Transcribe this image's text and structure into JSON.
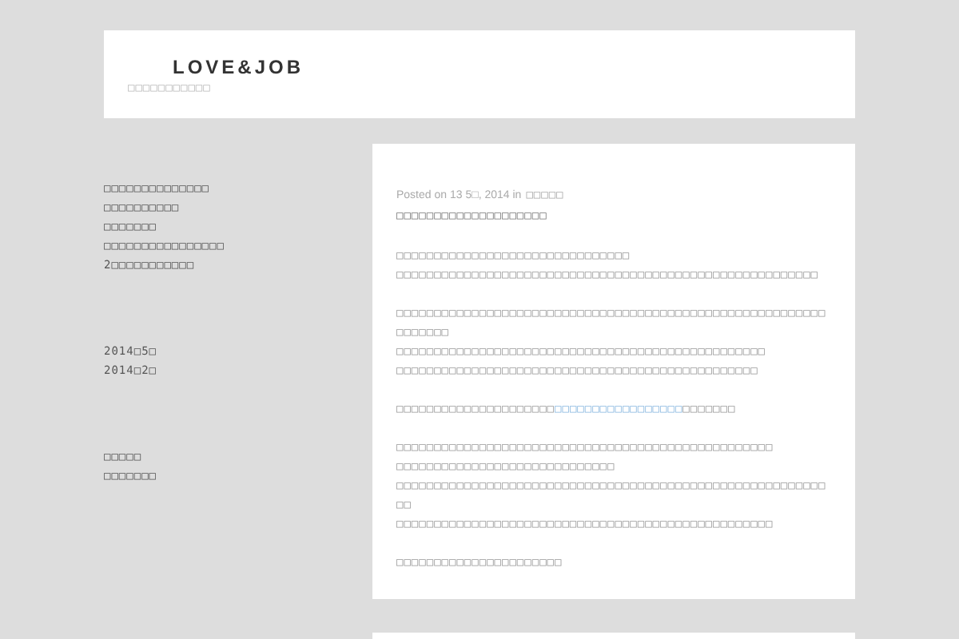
{
  "header": {
    "title": "LOVE&JOB",
    "tagline": "□□□□□□□□□□□"
  },
  "sidebar": {
    "recent_posts": [
      "□□□□□□□□□□□□□□",
      "□□□□□□□□□□",
      "□□□□□□□",
      "□□□□□□□□□□□□□□□□",
      "2□□□□□□□□□□□"
    ],
    "archives": [
      "2014□5□",
      "2014□2□"
    ],
    "categories": [
      "□□□□□",
      "□□□□□□□"
    ]
  },
  "post": {
    "meta_prefix": "Posted on 13 5□, 2014 in",
    "category": "□□□□□",
    "title": "□□□□□□□□□□□□□□□□□□□□",
    "paragraphs": [
      {
        "kind": "text",
        "lines": [
          "□□□□□□□□□□□□□□□□□□□□□□□□□□□□□□□",
          "□□□□□□□□□□□□□□□□□□□□□□□□□□□□□□□□□□□□□□□□□□□□□□□□□□□□□□□□"
        ]
      },
      {
        "kind": "text",
        "lines": [
          "□□□□□□□□□□□□□□□□□□□□□□□□□□□□□□□□□□□□□□□□□□□□□□□□□□□□□□□□□□□□□□□□",
          "□□□□□□□□□□□□□□□□□□□□□□□□□□□□□□□□□□□□□□□□□□□□□□□□□",
          "□□□□□□□□□□□□□□□□□□□□□□□□□□□□□□□□□□□□□□□□□□□□□□□□"
        ]
      },
      {
        "kind": "link",
        "before": "□□□□□□□□□□□□□□□□□□□□□",
        "link": "□□□□□□□□□□□□□□□□□",
        "after": "□□□□□□□"
      },
      {
        "kind": "text",
        "lines": [
          "□□□□□□□□□□□□□□□□□□□□□□□□□□□□□□□□□□□□□□□□□□□□□□□□□□",
          "□□□□□□□□□□□□□□□□□□□□□□□□□□□□□",
          "□□□□□□□□□□□□□□□□□□□□□□□□□□□□□□□□□□□□□□□□□□□□□□□□□□□□□□□□□□□",
          "□□□□□□□□□□□□□□□□□□□□□□□□□□□□□□□□□□□□□□□□□□□□□□□□□□"
        ]
      },
      {
        "kind": "text",
        "lines": [
          "□□□□□□□□□□□□□□□□□□□□□□"
        ]
      }
    ]
  }
}
